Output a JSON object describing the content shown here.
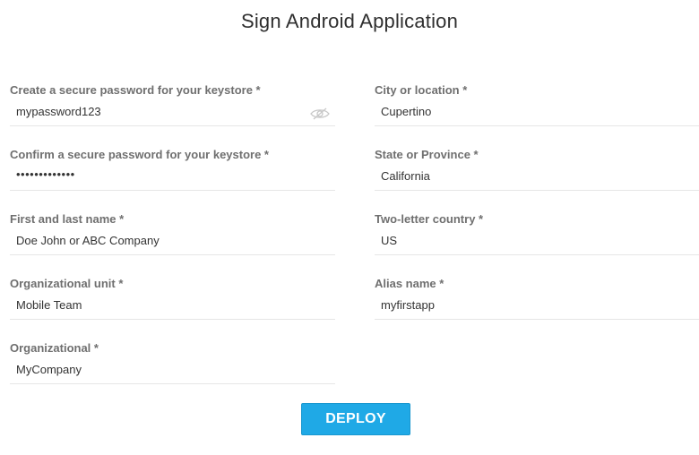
{
  "page": {
    "title": "Sign Android Application"
  },
  "form": {
    "keystore_password": {
      "label": "Create a secure password for your keystore *",
      "value": "mypassword123"
    },
    "confirm_password": {
      "label": "Confirm a secure password for your keystore *",
      "value": "•••••••••••••"
    },
    "full_name": {
      "label": "First and last name *",
      "value": "Doe John or ABC Company"
    },
    "org_unit": {
      "label": "Organizational unit *",
      "value": "Mobile Team"
    },
    "organization": {
      "label": "Organizational *",
      "value": "MyCompany"
    },
    "city": {
      "label": "City or location *",
      "value": "Cupertino"
    },
    "state": {
      "label": "State or Province *",
      "value": "California"
    },
    "country": {
      "label": "Two-letter country *",
      "value": "US"
    },
    "alias": {
      "label": "Alias name *",
      "value": "myfirstapp"
    }
  },
  "actions": {
    "deploy_label": "DEPLOY"
  },
  "icons": {
    "password_toggle": "eye-icon"
  },
  "colors": {
    "accent": "#1fa9e6",
    "label": "#6f6f6f",
    "divider": "#e6e6e6"
  }
}
